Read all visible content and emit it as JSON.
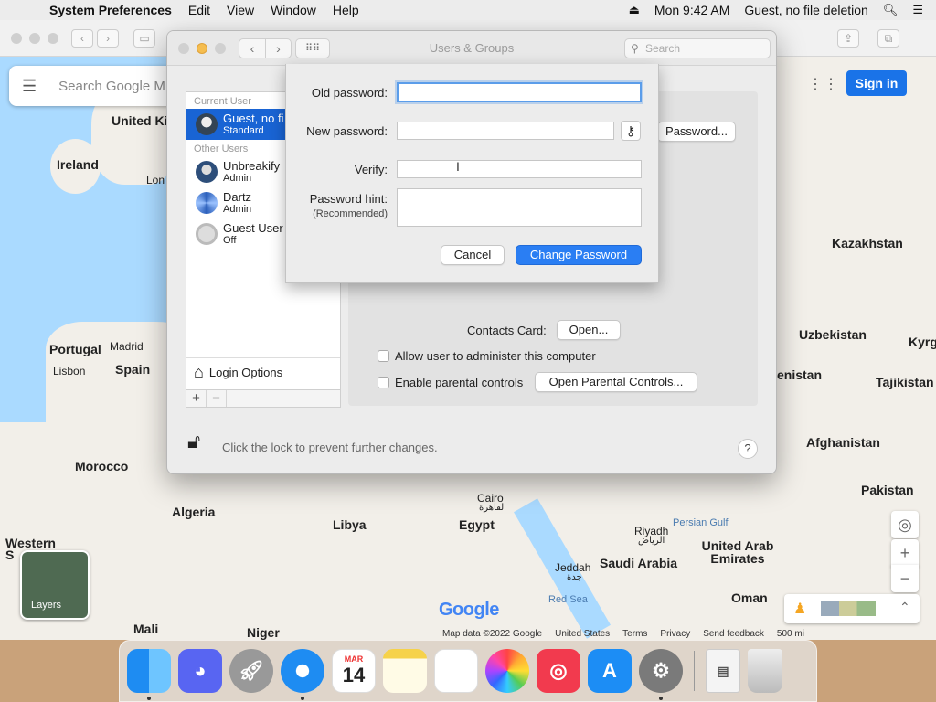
{
  "menubar": {
    "apple_icon": "apple-icon",
    "app_name": "System Preferences",
    "items": [
      "Edit",
      "View",
      "Window",
      "Help"
    ],
    "clock": "Mon 9:42 AM",
    "user": "Guest, no file deletion"
  },
  "map": {
    "search_placeholder": "Search Google M",
    "sign_in": "Sign in",
    "layers_label": "Layers",
    "google": "Google",
    "labels": [
      {
        "text": "United Kingdom"
      },
      {
        "text": "Ireland"
      },
      {
        "text": "Portugal"
      },
      {
        "text": "Madrid"
      },
      {
        "text": "Spain"
      },
      {
        "text": "Lisbon"
      },
      {
        "text": "Morocco"
      },
      {
        "text": "Algeria"
      },
      {
        "text": "Libya"
      },
      {
        "text": "Egypt"
      },
      {
        "text": "Cairo"
      },
      {
        "text": "القاهرة"
      },
      {
        "text": "Riyadh"
      },
      {
        "text": "الرياض"
      },
      {
        "text": "Saudi Arabia"
      },
      {
        "text": "Jeddah"
      },
      {
        "text": "جدة"
      },
      {
        "text": "Red Sea"
      },
      {
        "text": "Persian Gulf"
      },
      {
        "text": "United Arab Emirates"
      },
      {
        "text": "Oman"
      },
      {
        "text": "Kazakhstan"
      },
      {
        "text": "Uzbekistan"
      },
      {
        "text": "Kyrgy"
      },
      {
        "text": "Tajikistan"
      },
      {
        "text": "enistan"
      },
      {
        "text": "Afghanistan"
      },
      {
        "text": "Pakistan"
      },
      {
        "text": "Mali"
      },
      {
        "text": "Niger"
      },
      {
        "text": "Western S"
      },
      {
        "text": "Lon"
      }
    ],
    "footer": {
      "data": "Map data ©2022 Google",
      "country": "United States",
      "terms": "Terms",
      "privacy": "Privacy",
      "feedback": "Send feedback",
      "scale": "500 mi"
    }
  },
  "window": {
    "title": "Users & Groups",
    "search_placeholder": "Search",
    "current_user_label": "Current User",
    "other_users_label": "Other Users",
    "users": [
      {
        "name": "Guest, no file deletion",
        "role": "Standard"
      },
      {
        "name": "Unbreakify",
        "role": "Admin"
      },
      {
        "name": "Dartz",
        "role": "Admin"
      },
      {
        "name": "Guest User",
        "role": "Off"
      }
    ],
    "login_options": "Login Options",
    "add": "+",
    "remove": "−",
    "change_password_button": "Password...",
    "contacts_card_label": "Contacts Card:",
    "open_button": "Open...",
    "allow_admin_label": "Allow user to administer this computer",
    "parental_label": "Enable parental controls",
    "open_parental_button": "Open Parental Controls...",
    "lock_text": "Click the lock to prevent further changes.",
    "help": "?"
  },
  "sheet": {
    "old_password_label": "Old password:",
    "new_password_label": "New password:",
    "verify_label": "Verify:",
    "hint_label": "Password hint:",
    "hint_sub": "(Recommended)",
    "old_password_value": "",
    "new_password_value": "",
    "verify_value": "",
    "hint_value": "",
    "cancel": "Cancel",
    "change_password": "Change Password"
  },
  "dock": {
    "calendar_month": "MAR",
    "calendar_day": "14"
  },
  "colors": {
    "accent": "#2a7ef3",
    "selection": "#1964d4"
  }
}
